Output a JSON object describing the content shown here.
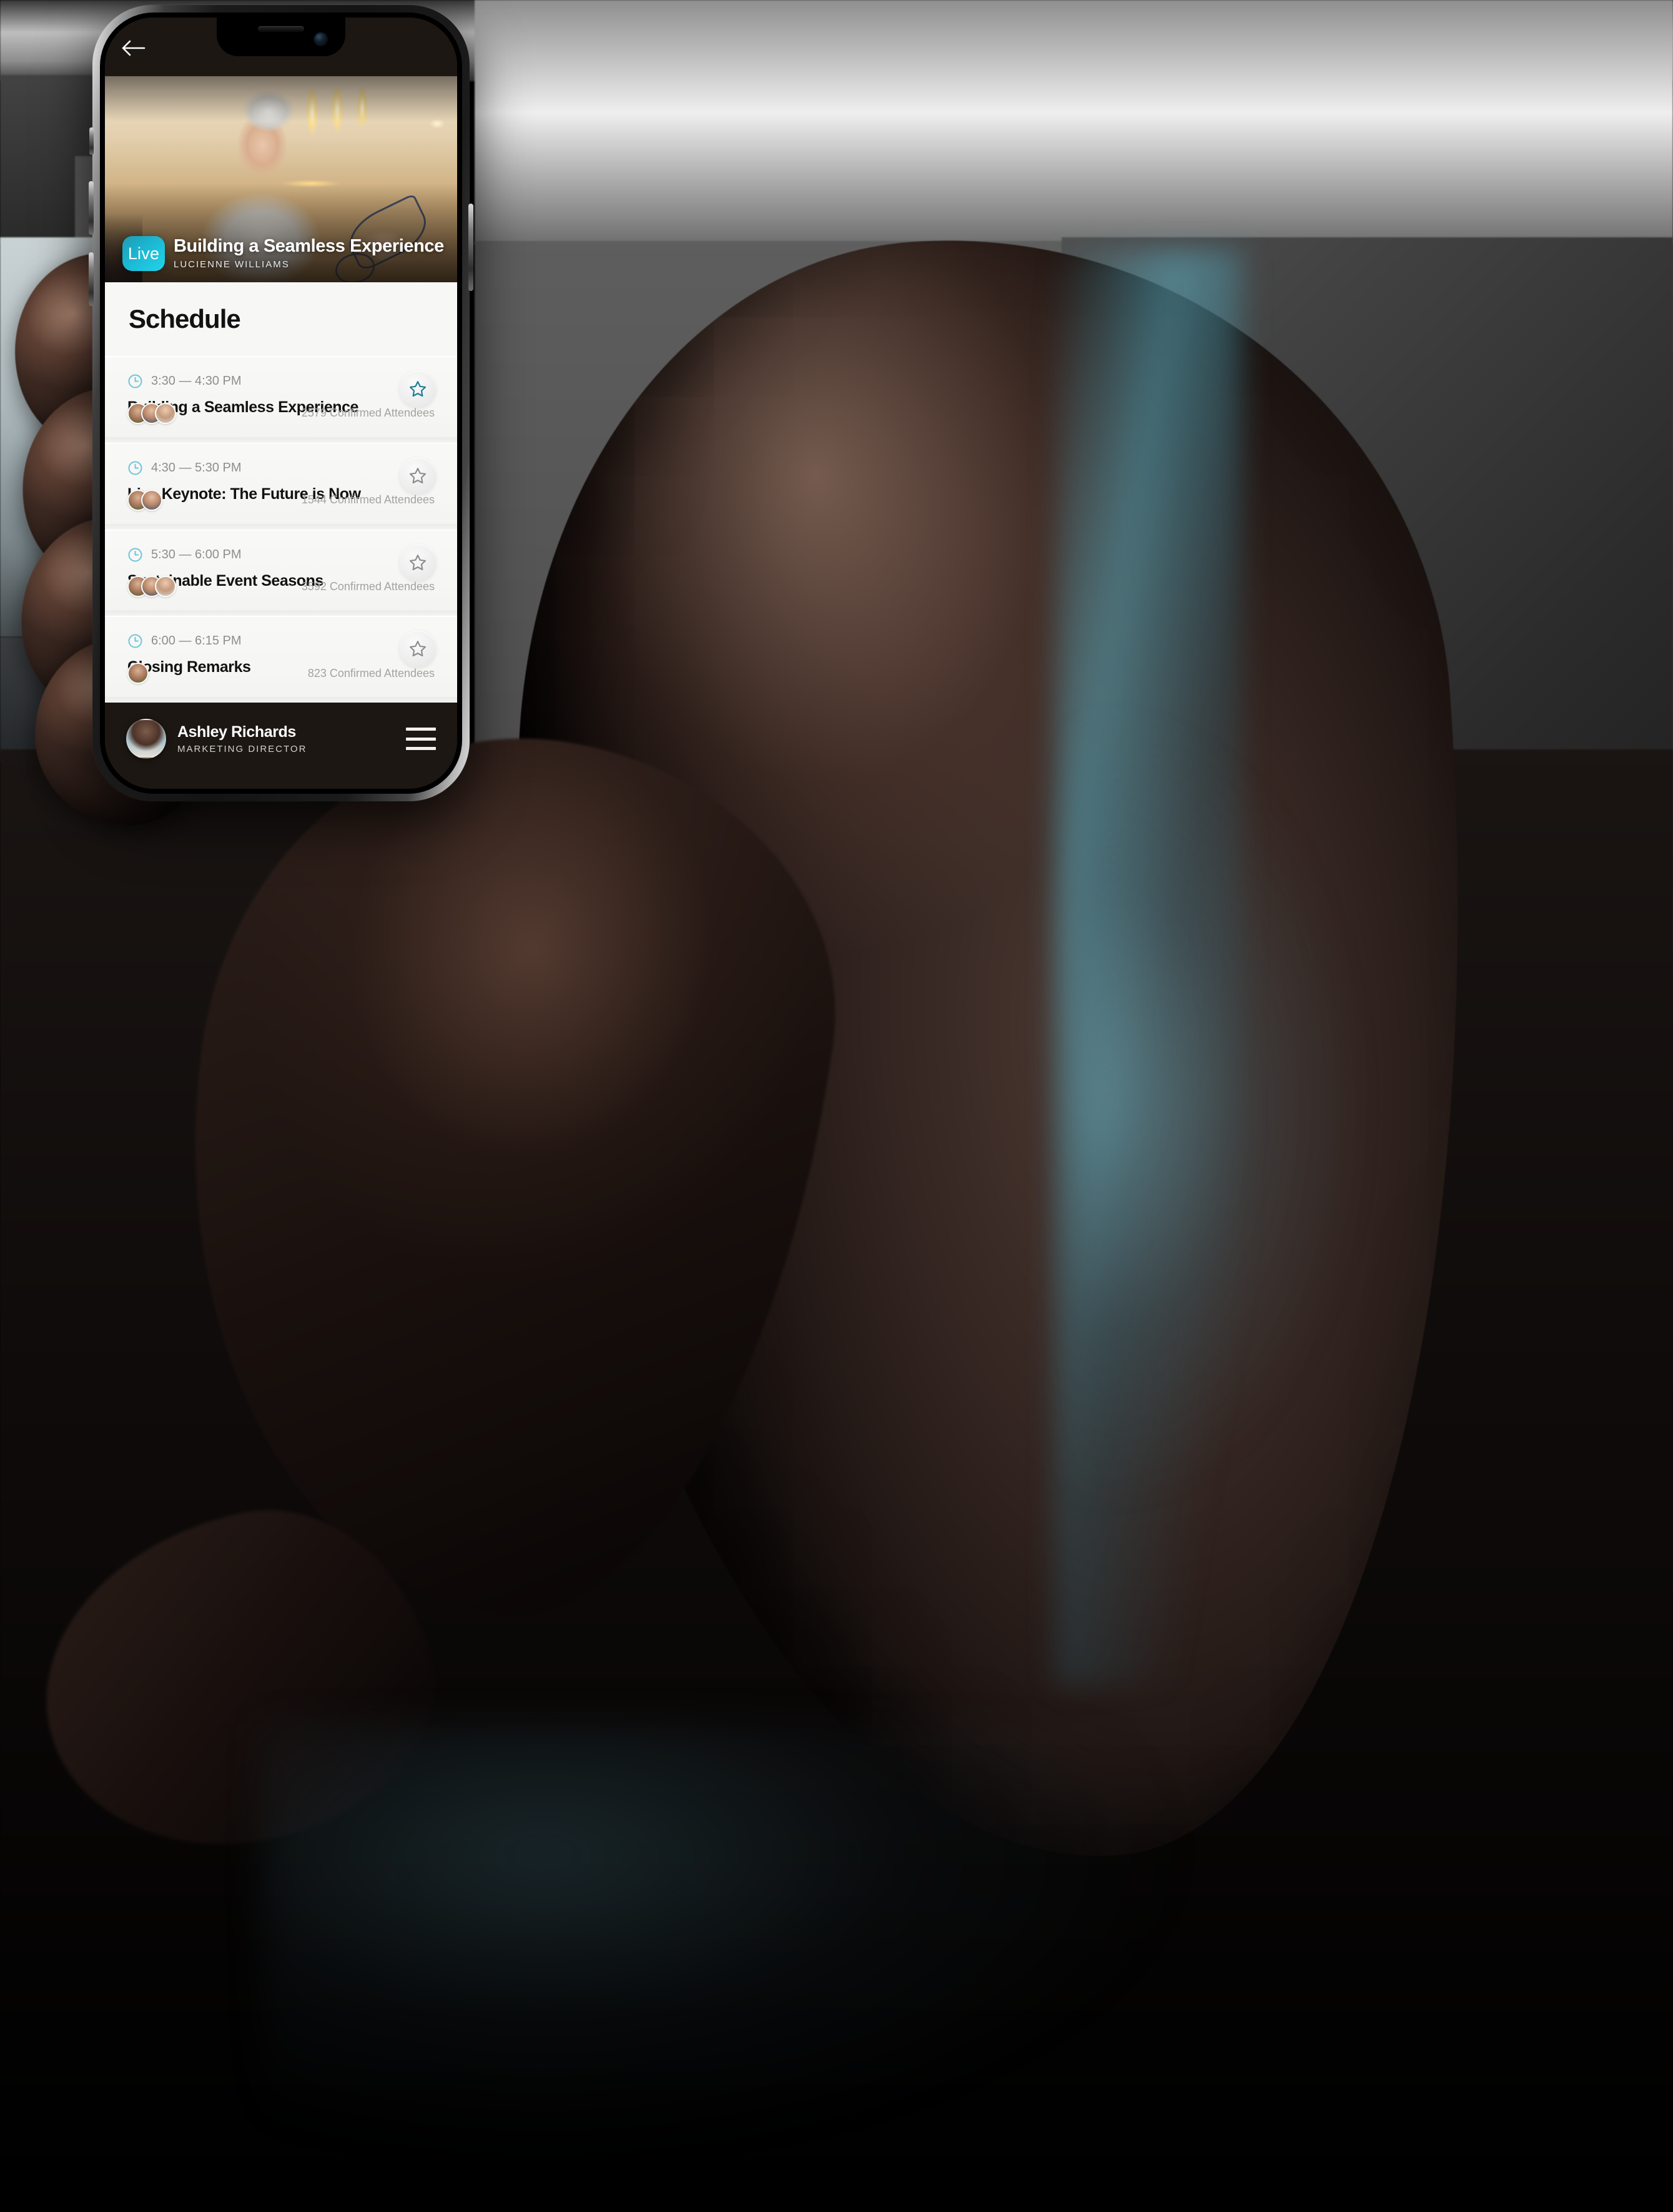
{
  "app": {
    "nav": {
      "back_icon": "arrow-left-icon"
    },
    "hero": {
      "badge": "Live",
      "title": "Building a Seamless Experience",
      "speaker": "LUCIENNE WILLIAMS"
    },
    "page_title": "Schedule",
    "attendees_suffix": "Confirmed Attendees",
    "schedule": [
      {
        "time": "3:30 — 4:30 PM",
        "title": "Building a Seamless Experience",
        "attendees": "2579 Confirmed Attendees",
        "starred": true,
        "avatar_count": 3
      },
      {
        "time": "4:30 — 5:30 PM",
        "title": "Live Keynote: The Future is Now",
        "attendees": "1544 Confirmed Attendees",
        "starred": false,
        "avatar_count": 2
      },
      {
        "time": "5:30 — 6:00 PM",
        "title": "Sustainable Event Seasons",
        "attendees": "3592 Confirmed Attendees",
        "starred": false,
        "avatar_count": 3
      },
      {
        "time": "6:00 — 6:15 PM",
        "title": "Closing Remarks",
        "attendees": "823 Confirmed Attendees",
        "starred": false,
        "avatar_count": 1
      }
    ],
    "footer": {
      "user_name": "Ashley Richards",
      "user_role": "MARKETING DIRECTOR",
      "menu_icon": "hamburger-menu-icon"
    }
  },
  "colors": {
    "accent_teal": "#1cb9d4",
    "star_active": "#1a7b95",
    "clock_icon": "#6cc5dc",
    "sheet_bg": "#f7f7f5",
    "chrome_dark": "#1c1713",
    "text_primary": "#121212",
    "text_muted": "#8e8e8e"
  }
}
